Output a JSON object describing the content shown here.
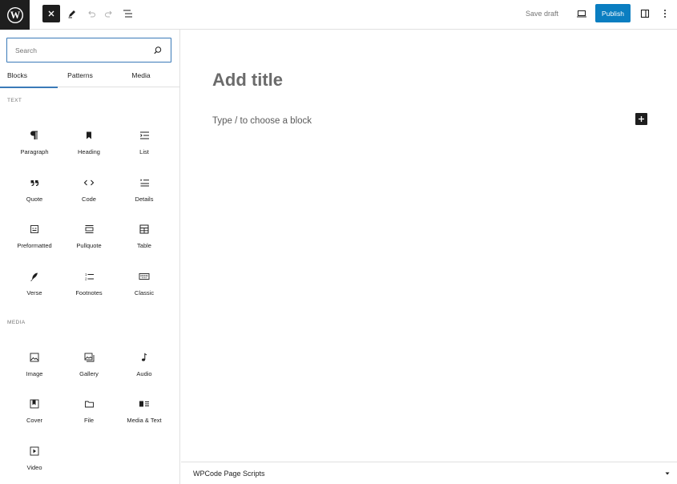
{
  "toolbar": {
    "logo_icon": "wordpress-logo-icon",
    "save_draft_label": "Save draft",
    "publish_label": "Publish",
    "accent_color": "#0a7ec1"
  },
  "inserter": {
    "search_placeholder": "Search",
    "tabs": [
      {
        "label": "Blocks",
        "active": true
      },
      {
        "label": "Patterns",
        "active": false
      },
      {
        "label": "Media",
        "active": false
      }
    ],
    "sections": [
      {
        "label": "TEXT",
        "blocks": [
          {
            "label": "Paragraph",
            "icon": "paragraph-icon"
          },
          {
            "label": "Heading",
            "icon": "heading-bookmark-icon"
          },
          {
            "label": "List",
            "icon": "list-icon"
          },
          {
            "label": "Quote",
            "icon": "quote-icon"
          },
          {
            "label": "Code",
            "icon": "code-icon"
          },
          {
            "label": "Details",
            "icon": "details-icon"
          },
          {
            "label": "Preformatted",
            "icon": "preformatted-icon"
          },
          {
            "label": "Pullquote",
            "icon": "pullquote-icon"
          },
          {
            "label": "Table",
            "icon": "table-icon"
          },
          {
            "label": "Verse",
            "icon": "verse-quill-icon"
          },
          {
            "label": "Footnotes",
            "icon": "footnotes-icon"
          },
          {
            "label": "Classic",
            "icon": "keyboard-icon"
          }
        ]
      },
      {
        "label": "MEDIA",
        "blocks": [
          {
            "label": "Image",
            "icon": "image-icon"
          },
          {
            "label": "Gallery",
            "icon": "gallery-icon"
          },
          {
            "label": "Audio",
            "icon": "audio-note-icon"
          },
          {
            "label": "Cover",
            "icon": "cover-icon"
          },
          {
            "label": "File",
            "icon": "folder-icon"
          },
          {
            "label": "Media & Text",
            "icon": "media-text-icon"
          },
          {
            "label": "Video",
            "icon": "video-play-icon"
          }
        ]
      }
    ]
  },
  "editor": {
    "title_placeholder": "Add title",
    "block_placeholder": "Type / to choose a block"
  },
  "metabox": {
    "title": "WPCode Page Scripts"
  }
}
